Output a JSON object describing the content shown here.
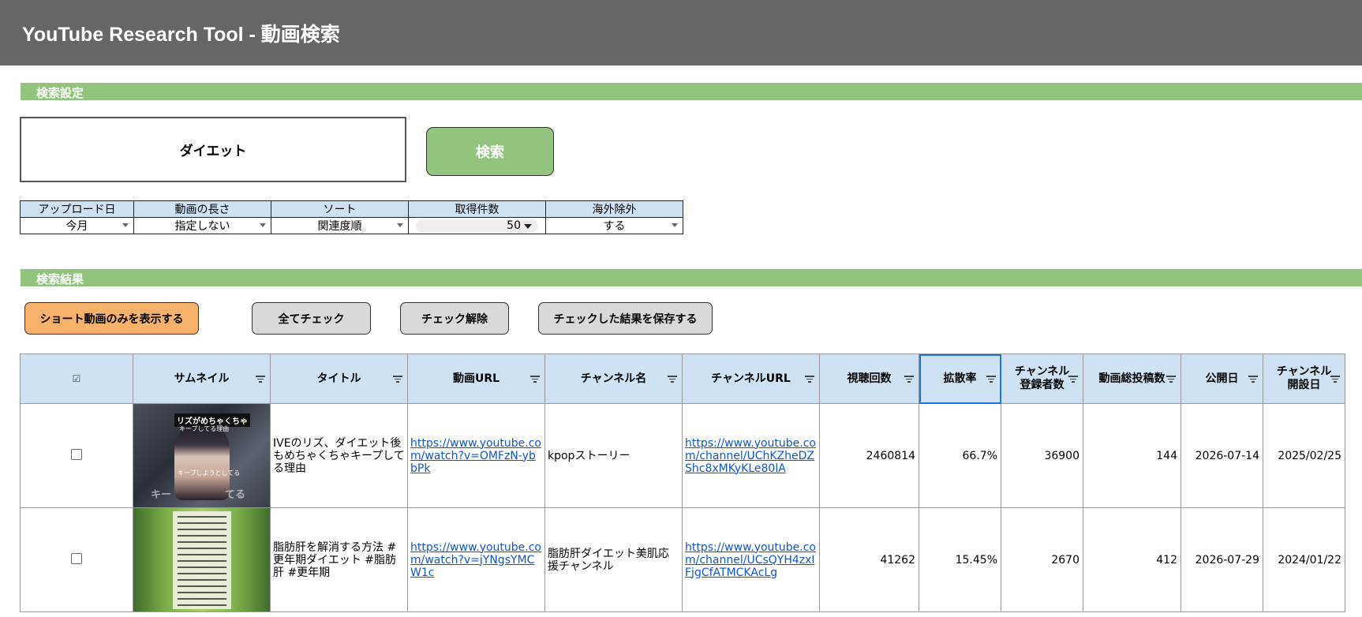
{
  "app": {
    "title": "YouTube Research Tool - 動画検索"
  },
  "search_section": {
    "label": "検索設定"
  },
  "search": {
    "keyword": "ダイエット",
    "button_label": "検索"
  },
  "options": {
    "headers": [
      "アップロード日",
      "動画の長さ",
      "ソート",
      "取得件数",
      "海外除外"
    ],
    "values": [
      "今月",
      "指定しない",
      "関連度順",
      "50",
      "する"
    ]
  },
  "results_section": {
    "label": "検索結果"
  },
  "actions": {
    "shorts_only": "ショート動画のみを表示する",
    "check_all": "全てチェック",
    "uncheck": "チェック解除",
    "save_checked": "チェックした結果を保存する"
  },
  "table": {
    "headers": {
      "check": "☑",
      "thumbnail": "サムネイル",
      "title": "タイトル",
      "video_url": "動画URL",
      "channel_name": "チャンネル名",
      "channel_url": "チャンネルURL",
      "views": "視聴回数",
      "spread_rate": "拡散率",
      "subscribers": "チャンネル\n登録者数",
      "total_videos": "動画総投稿数",
      "published": "公開日",
      "channel_created": "チャンネル\n開設日"
    },
    "rows": [
      {
        "thumb_caption_top": "リズがめちゃくちゃ",
        "thumb_caption_sub": "キープしてる理由",
        "thumb_caption_mid": "キープしようとしてる",
        "thumb_caption_left": "キー",
        "thumb_caption_right": "てる",
        "title": "IVEのリズ、ダイエット後もめちゃくちゃキープしてる理由",
        "video_url": "https://www.youtube.com/watch?v=OMFzN-ybbPk",
        "channel_name": "kpopストーリー",
        "channel_url": "https://www.youtube.com/channel/UChKZheDZShc8xMKyKLe80lA",
        "views": "2460814",
        "spread_rate": "66.7%",
        "subscribers": "36900",
        "total_videos": "144",
        "published": "2026-07-14",
        "channel_created": "2025/02/25"
      },
      {
        "title": "脂肪肝を解消する方法 #更年期ダイエット #脂肪肝 #更年期",
        "video_url": "https://www.youtube.com/watch?v=jYNgsYMCW1c",
        "channel_name": "脂肪肝ダイエット美肌応援チャンネル",
        "channel_url": "https://www.youtube.com/channel/UCsQYH4zxIFjgCfATMCKAcLg",
        "views": "41262",
        "spread_rate": "15.45%",
        "subscribers": "2670",
        "total_videos": "412",
        "published": "2026-07-29",
        "channel_created": "2024/01/22"
      }
    ]
  },
  "colors": {
    "title_bar": "#666666",
    "section_green": "#93c47d",
    "header_blue": "#cfe2f3",
    "button_orange": "#f6b26b",
    "button_gray": "#d9d9d9",
    "link": "#1155cc"
  }
}
